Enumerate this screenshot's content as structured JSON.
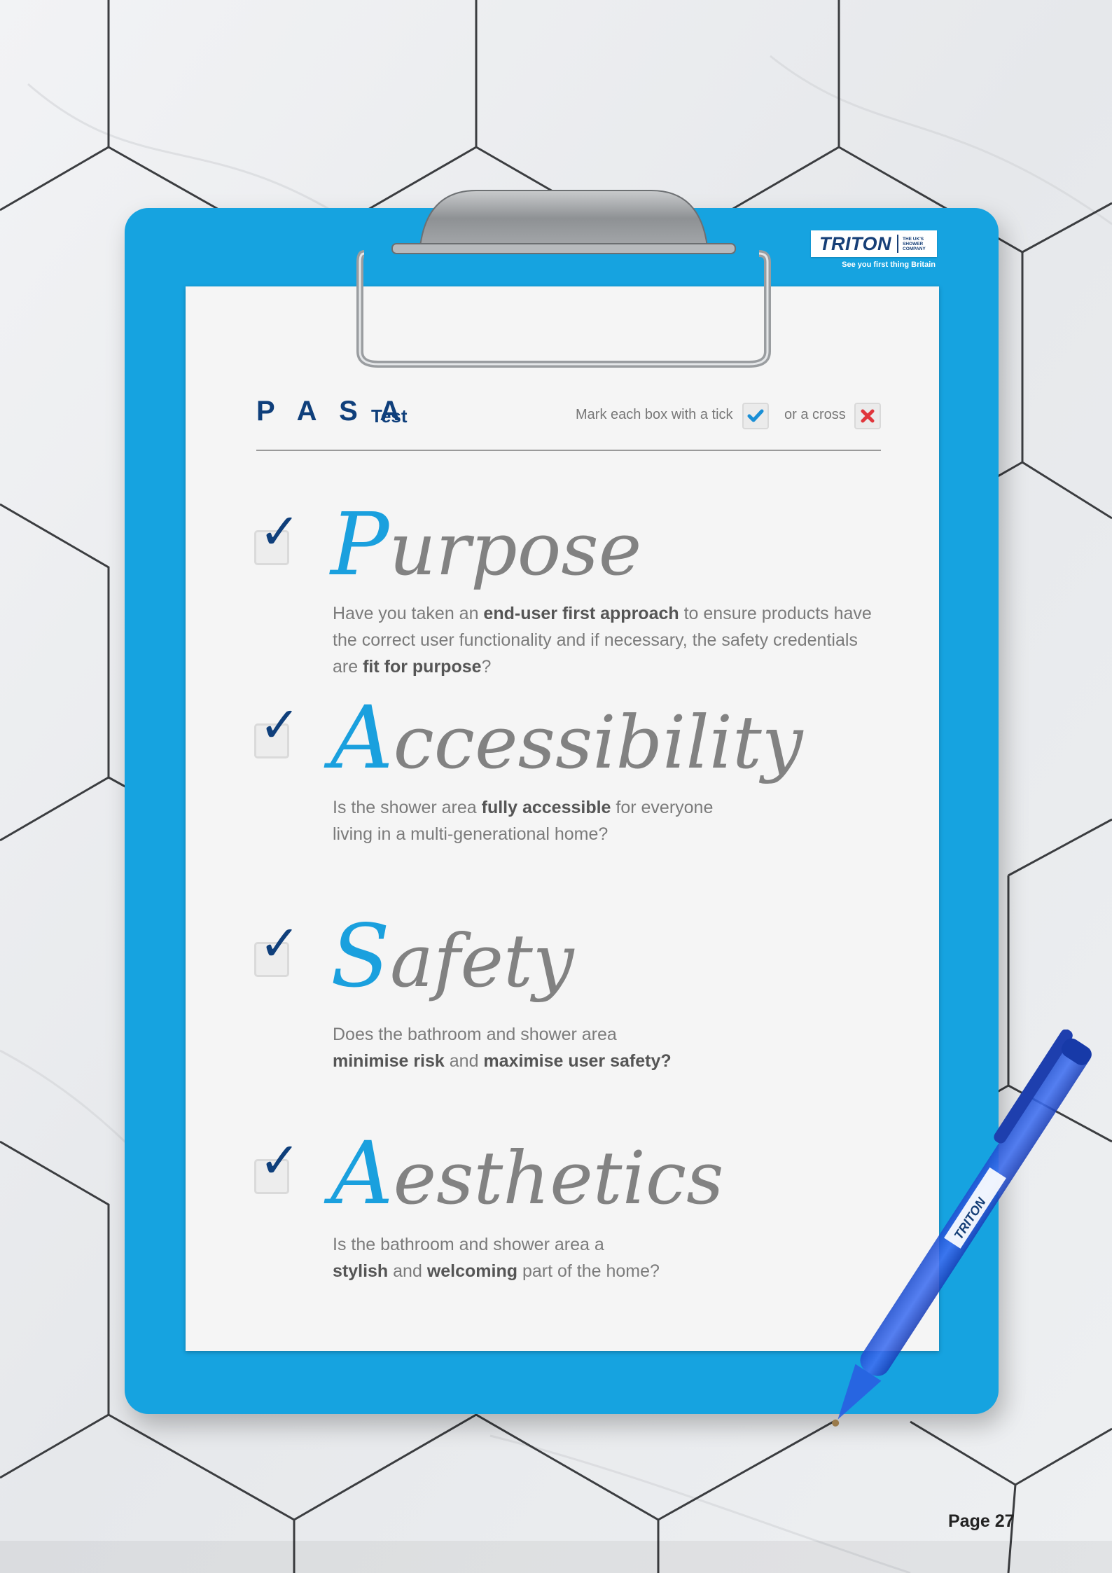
{
  "brand": {
    "name": "TRITON",
    "tagline_lines": [
      "THE UK'S",
      "SHOWER",
      "COMPANY"
    ],
    "slogan": "See you first thing Britain",
    "pen_label": "TRITON"
  },
  "header": {
    "title": "P A S A",
    "title_suffix": "Test",
    "instruction": "Mark each box with a tick",
    "or_text": "or a cross"
  },
  "items": [
    {
      "initial": "P",
      "rest": "urpose",
      "checked": true,
      "desc": [
        {
          "t": "Have you taken an "
        },
        {
          "t": "end-user first approach",
          "b": true
        },
        {
          "t": " to ensure products have the correct user functionality and if necessary, the safety credentials are "
        },
        {
          "t": "fit for purpose",
          "b": true
        },
        {
          "t": "?"
        }
      ]
    },
    {
      "initial": "A",
      "rest": "ccessibility",
      "checked": true,
      "desc": [
        {
          "t": "Is the shower area "
        },
        {
          "t": "fully accessible",
          "b": true
        },
        {
          "t": " for everyone living in a multi-generational home?"
        }
      ]
    },
    {
      "initial": "S",
      "rest": "afety",
      "checked": true,
      "desc": [
        {
          "t": "Does the bathroom and shower area "
        },
        {
          "t": "minimise risk",
          "b": true
        },
        {
          "t": " and "
        },
        {
          "t": "maximise user safety?",
          "b": true
        }
      ]
    },
    {
      "initial": "A",
      "rest": "esthetics",
      "checked": true,
      "desc": [
        {
          "t": "Is the bathroom and shower area a "
        },
        {
          "t": "stylish",
          "b": true
        },
        {
          "t": " and "
        },
        {
          "t": "welcoming",
          "b": true
        },
        {
          "t": " part of the home?"
        }
      ]
    }
  ],
  "icons": {
    "tick": "✓",
    "header_tick": "checkmark-icon",
    "header_cross": "cross-icon"
  },
  "colors": {
    "accent_blue": "#16a3e0",
    "navy": "#0f3f7b",
    "cross_red": "#e0353b",
    "pen_blue": "#2457d6"
  },
  "footer": {
    "page": "Page 27"
  }
}
